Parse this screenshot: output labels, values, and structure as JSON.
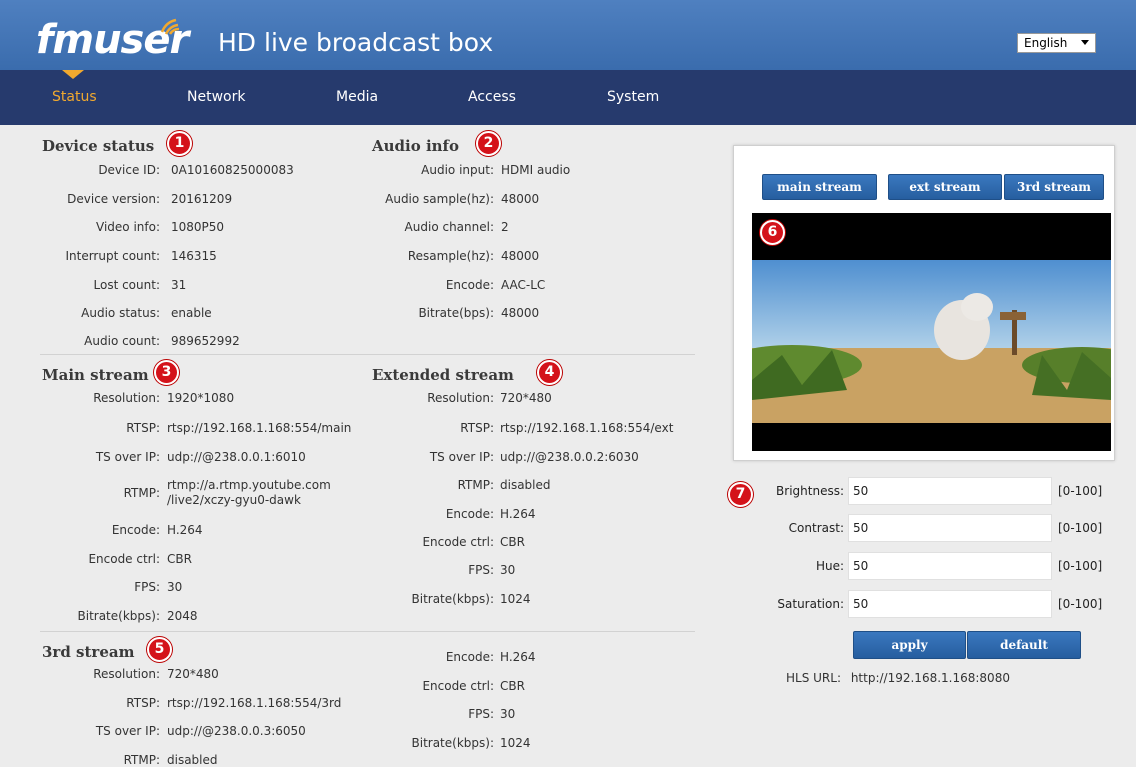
{
  "header": {
    "logo": "fmuser",
    "subtitle": "HD live broadcast box",
    "language": "English"
  },
  "nav": {
    "items": [
      "Status",
      "Network",
      "Media",
      "Access",
      "System"
    ],
    "active": "Status"
  },
  "device_status": {
    "title": "Device status",
    "badge": "1",
    "rows": [
      {
        "label": "Device ID:",
        "value": "0A10160825000083"
      },
      {
        "label": "Device version:",
        "value": "20161209"
      },
      {
        "label": "Video info:",
        "value": "1080P50"
      },
      {
        "label": "Interrupt count:",
        "value": "146315"
      },
      {
        "label": "Lost count:",
        "value": "31"
      },
      {
        "label": "Audio status:",
        "value": "enable"
      },
      {
        "label": "Audio count:",
        "value": "989652992"
      }
    ]
  },
  "audio_info": {
    "title": "Audio info",
    "badge": "2",
    "rows": [
      {
        "label": "Audio input:",
        "value": "HDMI audio"
      },
      {
        "label": "Audio sample(hz):",
        "value": "48000"
      },
      {
        "label": "Audio channel:",
        "value": "2"
      },
      {
        "label": "Resample(hz):",
        "value": "48000"
      },
      {
        "label": "Encode:",
        "value": "AAC-LC"
      },
      {
        "label": "Bitrate(bps):",
        "value": "48000"
      }
    ]
  },
  "main_stream": {
    "title": "Main stream",
    "badge": "3",
    "rows": [
      {
        "label": "Resolution:",
        "value": "1920*1080"
      },
      {
        "label": "RTSP:",
        "value": "rtsp://192.168.1.168:554/main"
      },
      {
        "label": "TS over IP:",
        "value": "udp://@238.0.0.1:6010"
      },
      {
        "label": "RTMP:",
        "value": "rtmp://a.rtmp.youtube.com",
        "value2": "/live2/xczy-gyu0-dawk"
      },
      {
        "label": "Encode:",
        "value": "H.264"
      },
      {
        "label": "Encode ctrl:",
        "value": "CBR"
      },
      {
        "label": "FPS:",
        "value": "30"
      },
      {
        "label": "Bitrate(kbps):",
        "value": "2048"
      }
    ]
  },
  "extended_stream": {
    "title": "Extended stream",
    "badge": "4",
    "rows": [
      {
        "label": "Resolution:",
        "value": "720*480"
      },
      {
        "label": "RTSP:",
        "value": "rtsp://192.168.1.168:554/ext"
      },
      {
        "label": "TS over IP:",
        "value": "udp://@238.0.0.2:6030"
      },
      {
        "label": "RTMP:",
        "value": "disabled"
      },
      {
        "label": "Encode:",
        "value": "H.264"
      },
      {
        "label": "Encode ctrl:",
        "value": "CBR"
      },
      {
        "label": "FPS:",
        "value": "30"
      },
      {
        "label": "Bitrate(kbps):",
        "value": "1024"
      }
    ]
  },
  "third_stream": {
    "title": "3rd stream",
    "badge": "5",
    "rows_left": [
      {
        "label": "Resolution:",
        "value": "720*480"
      },
      {
        "label": "RTSP:",
        "value": "rtsp://192.168.1.168:554/3rd"
      },
      {
        "label": "TS over IP:",
        "value": "udp://@238.0.0.3:6050"
      },
      {
        "label": "RTMP:",
        "value": "disabled"
      }
    ],
    "rows_right": [
      {
        "label": "Encode:",
        "value": "H.264"
      },
      {
        "label": "Encode ctrl:",
        "value": "CBR"
      },
      {
        "label": "FPS:",
        "value": "30"
      },
      {
        "label": "Bitrate(kbps):",
        "value": "1024"
      }
    ]
  },
  "preview": {
    "badge": "6",
    "buttons": [
      "main stream",
      "ext stream",
      "3rd stream"
    ]
  },
  "settings": {
    "badge": "7",
    "rows": [
      {
        "label": "Brightness:",
        "value": "50",
        "range": "[0-100]"
      },
      {
        "label": "Contrast:",
        "value": "50",
        "range": "[0-100]"
      },
      {
        "label": "Hue:",
        "value": "50",
        "range": "[0-100]"
      },
      {
        "label": "Saturation:",
        "value": "50",
        "range": "[0-100]"
      }
    ],
    "apply_label": "apply",
    "default_label": "default",
    "hls_label": "HLS URL:",
    "hls_value": "http://192.168.1.168:8080"
  },
  "colors": {
    "header_blue": "#3a6cad",
    "nav_navy": "#263a6d",
    "active_orange": "#f1a92f",
    "badge_red": "#d4121a",
    "button_blue": "#2d6aad"
  }
}
